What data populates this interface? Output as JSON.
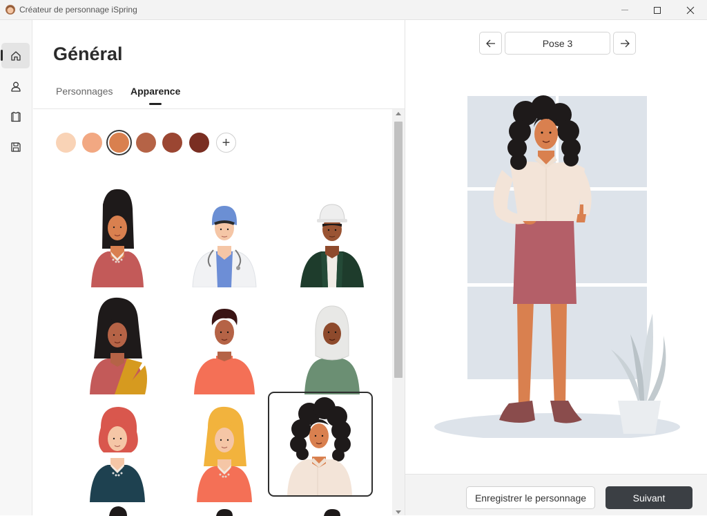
{
  "window": {
    "title": "Créateur de personnage iSpring",
    "app_icon": "character-avatar-icon"
  },
  "rail": {
    "items": [
      {
        "name": "home",
        "icon": "home-icon",
        "active": true
      },
      {
        "name": "character",
        "icon": "user-icon",
        "active": false
      },
      {
        "name": "clothing",
        "icon": "shirt-icon",
        "active": false
      },
      {
        "name": "save",
        "icon": "save-icon",
        "active": false
      }
    ]
  },
  "editor": {
    "title": "Général",
    "tabs": [
      {
        "label": "Personnages",
        "active": false
      },
      {
        "label": "Apparence",
        "active": true
      }
    ],
    "skin_tones": [
      "#f9d3b6",
      "#f2a882",
      "#d9804f",
      "#b56346",
      "#9b4632",
      "#7a2e22"
    ],
    "selected_skin_tone_index": 2,
    "add_swatch_label": "+",
    "characters": [
      {
        "id": "woman-cardigan",
        "selected": false
      },
      {
        "id": "doctor",
        "selected": false
      },
      {
        "id": "construction-worker",
        "selected": false
      },
      {
        "id": "woman-sari",
        "selected": false
      },
      {
        "id": "man-sweater",
        "selected": false
      },
      {
        "id": "woman-hijab",
        "selected": false
      },
      {
        "id": "redhead-woman",
        "selected": false
      },
      {
        "id": "blonde-woman",
        "selected": false
      },
      {
        "id": "curly-hair-woman",
        "selected": true
      }
    ]
  },
  "preview": {
    "pose_label": "Pose 3",
    "prev_icon": "arrow-left-icon",
    "next_icon": "arrow-right-icon"
  },
  "footer": {
    "save_label": "Enregistrer le personnage",
    "next_label": "Suivant"
  },
  "colors": {
    "accent_dark": "#3b3f44",
    "background_panel": "#dde3ea"
  }
}
